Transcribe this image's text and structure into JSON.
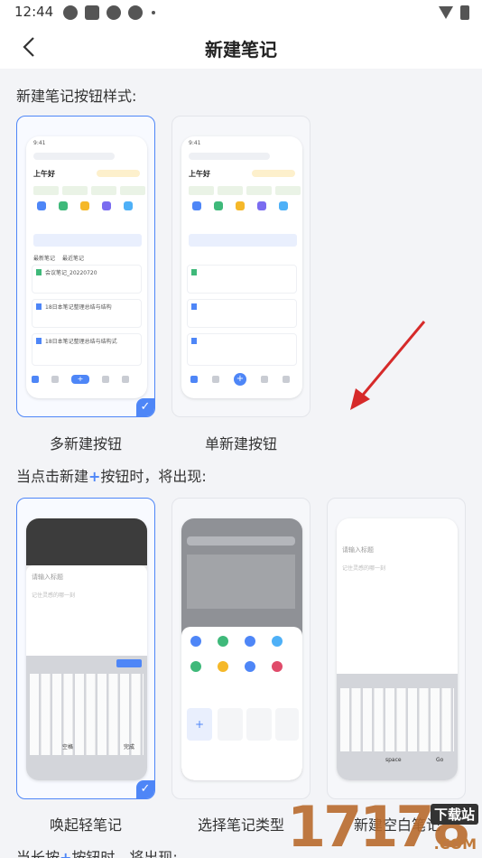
{
  "status_bar": {
    "time": "12:44"
  },
  "header": {
    "title": "新建笔记",
    "back_icon": "chevron-left-icon"
  },
  "section1": {
    "label": "新建笔记按钮样式:",
    "options": [
      {
        "caption": "多新建按钮",
        "selected": true
      },
      {
        "caption": "单新建按钮",
        "selected": false
      }
    ]
  },
  "section2": {
    "label_before": "当点击新建",
    "label_plus": "+",
    "label_after": "按钮时，将出现:",
    "options": [
      {
        "caption": "唤起轻笔记",
        "selected": true
      },
      {
        "caption": "选择笔记类型",
        "selected": false
      },
      {
        "caption": "新建空白笔记",
        "selected": false
      }
    ]
  },
  "section3": {
    "label_before": "当长按",
    "label_plus": "+",
    "label_after": "按钮时，将出现:"
  },
  "mock": {
    "greeting": "上午好",
    "tab_recent": "最新笔记",
    "tab_share": "最近笔记",
    "note1": "会议笔记_20220720",
    "note2": "18日本笔记整理总结与结构",
    "note3": "18日本笔记整理总结与结构式",
    "placeholder_title": "请输入标题",
    "placeholder_body": "记住灵感的哪一刻",
    "kb_space": "空格",
    "kb_done": "完成",
    "kb_space2": "space",
    "kb_go": "Go"
  },
  "watermark": {
    "digits": "17178",
    "tag": "下载站",
    "domain": ".COM"
  },
  "colors": {
    "accent": "#4e86f7",
    "red_arrow": "#d62a2a"
  }
}
